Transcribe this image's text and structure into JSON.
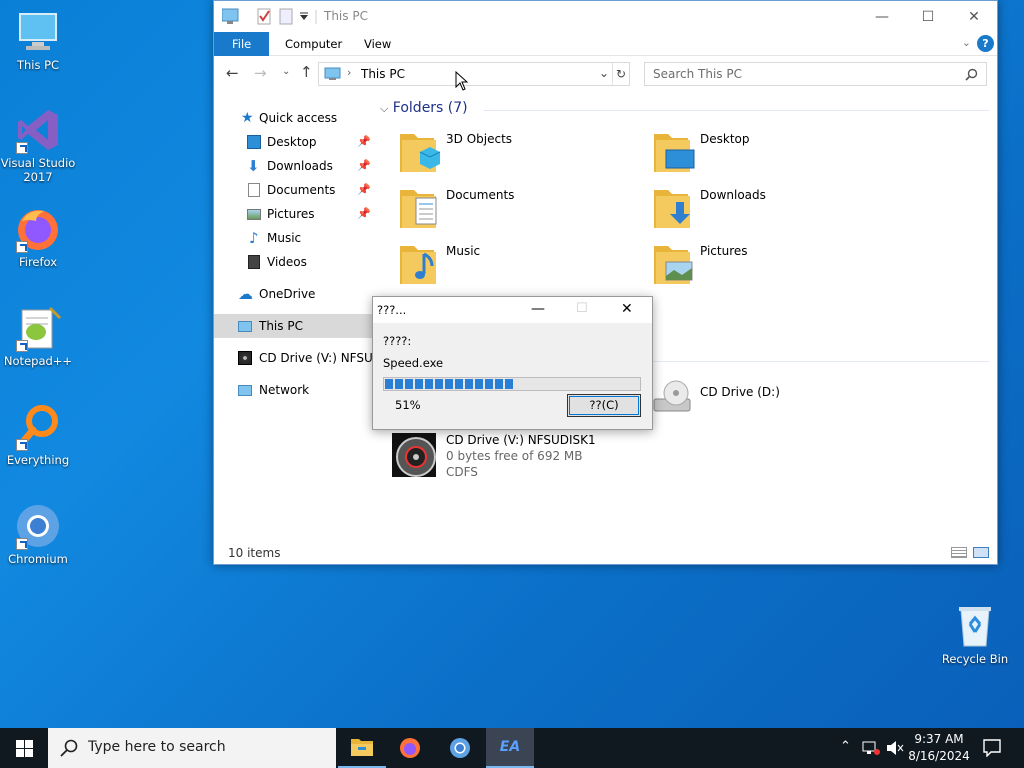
{
  "desktop": {
    "icons": [
      {
        "label": "This PC"
      },
      {
        "label": "Visual Studio 2017"
      },
      {
        "label": "Firefox"
      },
      {
        "label": "Notepad++"
      },
      {
        "label": "Everything"
      },
      {
        "label": "Chromium"
      },
      {
        "label": "Recycle Bin"
      }
    ]
  },
  "explorer": {
    "title": "This PC",
    "ribbon_tabs": [
      "File",
      "Computer",
      "View"
    ],
    "address_path": "This PC",
    "search_placeholder": "Search This PC",
    "nav": {
      "quick_access": "Quick access",
      "items": [
        "Desktop",
        "Downloads",
        "Documents",
        "Pictures",
        "Music",
        "Videos"
      ],
      "onedrive": "OneDrive",
      "this_pc": "This PC",
      "cd_drive": "CD Drive (V:) NFSUDI",
      "network": "Network"
    },
    "folders_header": "Folders (7)",
    "folders": [
      "3D Objects",
      "Desktop",
      "Documents",
      "Downloads",
      "Music",
      "Pictures"
    ],
    "drives": {
      "d_name": "CD Drive (D:)",
      "v_name": "CD Drive (V:) NFSUDISK1",
      "v_free": "0 bytes free of 692 MB",
      "v_fs": "CDFS"
    },
    "status": "10 items"
  },
  "dialog": {
    "title": "???...",
    "label": "????:",
    "file": "Speed.exe",
    "progress_percent": 51,
    "progress_label": "51%",
    "cancel_label": "??(C)"
  },
  "taskbar": {
    "search_placeholder": "Type here to search",
    "time": "9:37 AM",
    "date": "8/16/2024"
  },
  "colors": {
    "accent": "#1979ca",
    "folder": "#f4c95d",
    "progress": "#2a7fd4"
  }
}
